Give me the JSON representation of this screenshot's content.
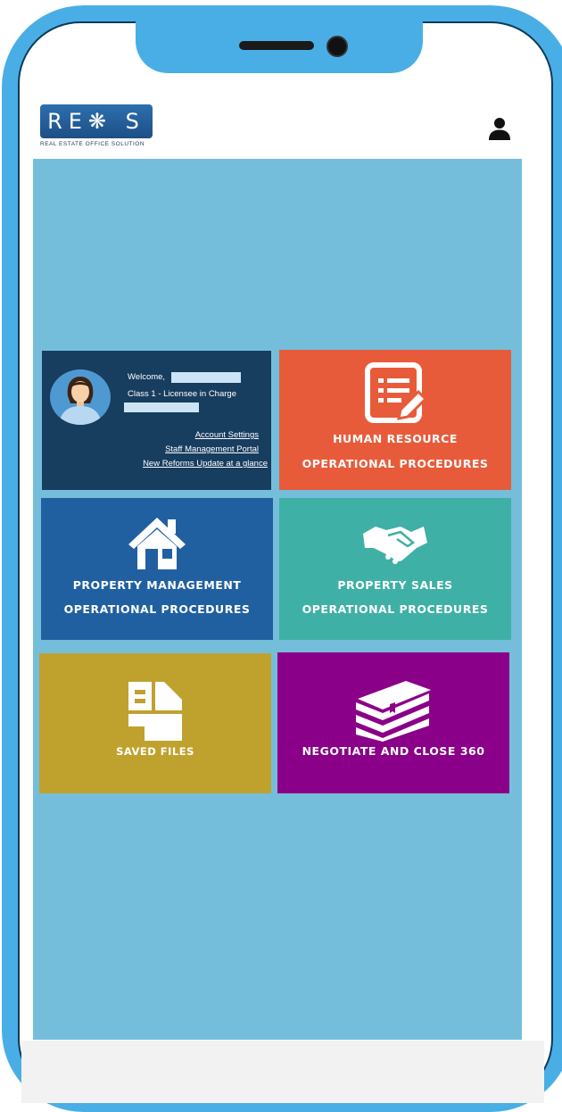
{
  "header": {
    "logo_text": "RE❋ S",
    "logo_subtitle": "REAL ESTATE OFFICE SOLUTION",
    "profile_icon": "person-icon"
  },
  "welcome_card": {
    "welcome_label": "Welcome,",
    "role": "Class 1 - Licensee in Charge",
    "links": {
      "account_settings": "Account Settings",
      "staff_portal": "Staff Management Portal",
      "reforms_update": "New Reforms Update at a glance"
    }
  },
  "tiles": {
    "hr": {
      "line1": "HUMAN RESOURCE",
      "line2": "OPERATIONAL  PROCEDURES",
      "icon": "document-edit-icon"
    },
    "pm": {
      "line1": "PROPERTY  MANAGEMENT",
      "line2": "OPERATIONAL  PROCEDURES",
      "icon": "house-icon"
    },
    "ps": {
      "line1": "PROPERTY  SALES",
      "line2": "OPERATIONAL  PROCEDURES",
      "icon": "handshake-icon"
    },
    "saved": {
      "label": "SAVED  FILES",
      "icon": "files-icon"
    },
    "nego": {
      "label": "NEGOTIATE  AND  CLOSE  360",
      "icon": "books-icon"
    }
  },
  "colors": {
    "frame": "#4aaee6",
    "content_bg": "#74bedb",
    "welcome": "#173d5f",
    "hr": "#e85b3a",
    "pm": "#2160a0",
    "ps": "#3fb0a5",
    "saved": "#bfa22e",
    "nego": "#8b0088"
  }
}
